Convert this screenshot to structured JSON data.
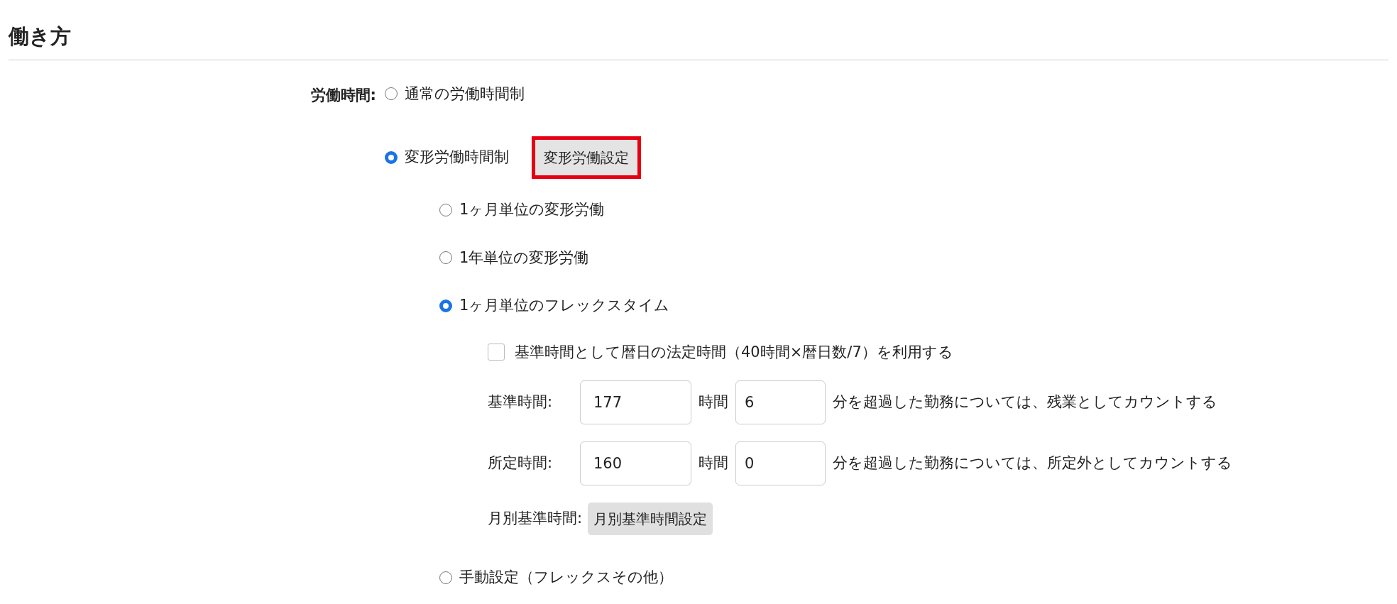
{
  "section": {
    "title": "働き方"
  },
  "working_hours": {
    "label": "労働時間:",
    "options": [
      {
        "label": "通常の労働時間制",
        "selected": false
      },
      {
        "label": "変形労働時間制",
        "selected": true,
        "button": {
          "label": "変形労働設定",
          "highlighted": true
        }
      }
    ]
  },
  "variable_types": [
    {
      "label": "1ヶ月単位の変形労働",
      "selected": false
    },
    {
      "label": "1年単位の変形労働",
      "selected": false
    },
    {
      "label": "1ヶ月単位のフレックスタイム",
      "selected": true,
      "settings": {
        "checkbox": {
          "label": "基準時間として暦日の法定時間（40時間×暦日数/7）を利用する",
          "checked": false
        },
        "rows": [
          {
            "label": "基準時間:",
            "hours": "177",
            "unit": "時間",
            "minutes": "6",
            "note": "分を超過した勤務については、残業としてカウントする"
          },
          {
            "label": "所定時間:",
            "hours": "160",
            "unit": "時間",
            "minutes": "0",
            "note": "分を超過した勤務については、所定外としてカウントする"
          }
        ],
        "monthly": {
          "label": "月別基準時間:",
          "button": "月別基準時間設定"
        }
      }
    },
    {
      "label": "手動設定（フレックスその他）",
      "selected": false
    }
  ]
}
